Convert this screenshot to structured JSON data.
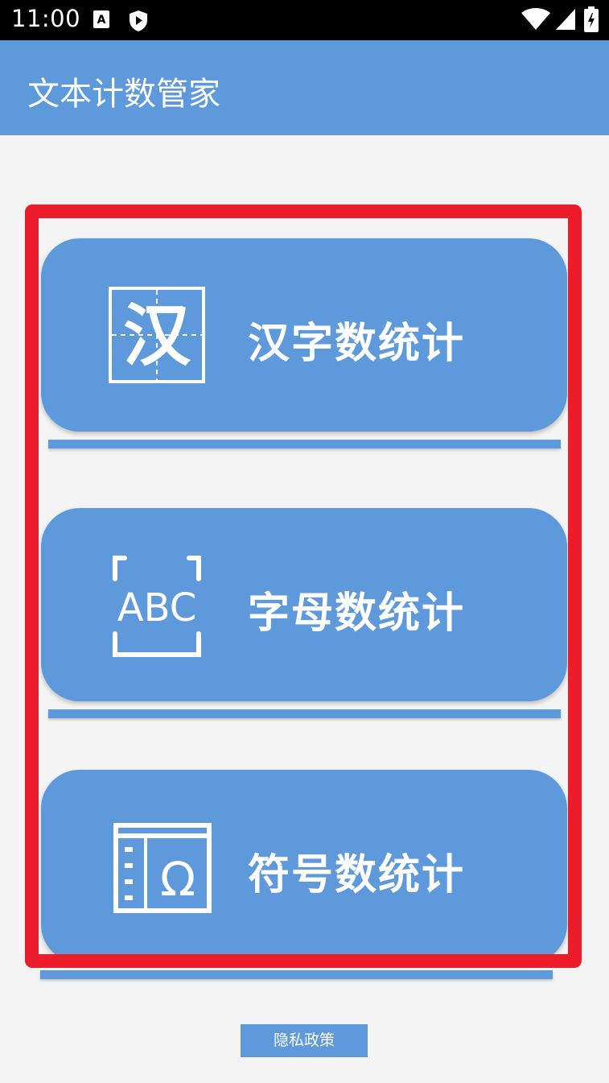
{
  "status_bar": {
    "time": "11:00",
    "icons": [
      "font-a-icon",
      "shield-play-icon",
      "wifi-icon",
      "signal-icon",
      "battery-charging-icon"
    ]
  },
  "app_bar": {
    "title": "文本计数管家"
  },
  "cards": [
    {
      "label": "汉字数统计",
      "icon": "hanzi-grid-icon",
      "icon_text": "汉"
    },
    {
      "label": "字母数统计",
      "icon": "abc-letters-icon",
      "icon_text": "ABC"
    },
    {
      "label": "符号数统计",
      "icon": "omega-symbol-icon",
      "icon_text": "Ω"
    }
  ],
  "footer": {
    "privacy_label": "隐私政策"
  },
  "colors": {
    "primary": "#5e99dc",
    "highlight": "#ec1c2b",
    "background": "#f4f4f5"
  }
}
